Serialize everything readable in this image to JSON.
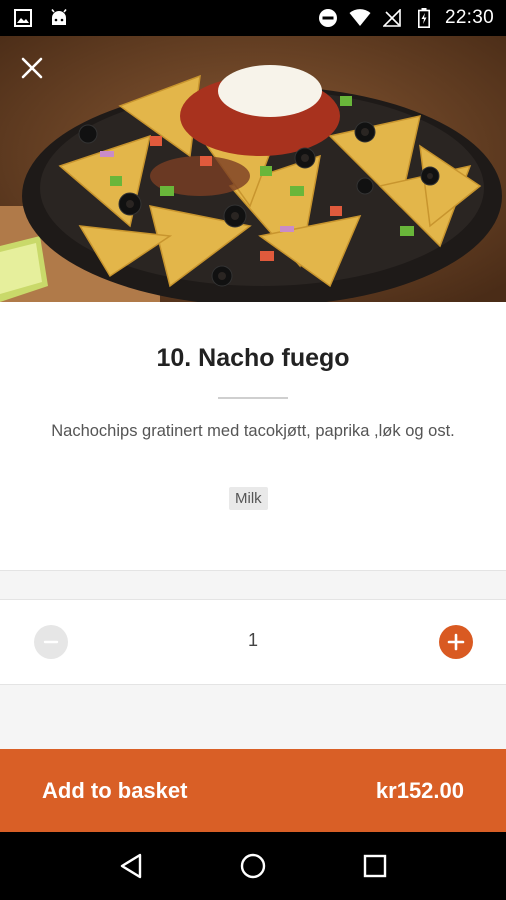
{
  "status_bar": {
    "time": "22:30",
    "icons": [
      "gallery-icon",
      "android-icon",
      "do-not-disturb-icon",
      "wifi-icon",
      "signal-icon",
      "battery-charging-icon"
    ]
  },
  "hero": {
    "image_subject": "nachos in cast iron skillet"
  },
  "header": {
    "close_icon": "close-icon"
  },
  "product": {
    "title": "10. Nacho fuego",
    "description": "Nachochips gratinert med tacokjøtt, paprika ,løk og ost.",
    "allergens": [
      "Milk"
    ]
  },
  "quantity": {
    "value": "1",
    "decrement_icon": "minus-icon",
    "increment_icon": "plus-icon"
  },
  "basket": {
    "label": "Add to basket",
    "price": "kr152.00"
  },
  "nav_bar": {
    "icons": [
      "back-icon",
      "home-icon",
      "recents-icon"
    ]
  },
  "colors": {
    "accent": "#d95f26",
    "minus_disabled": "#e6e6e6",
    "status_bar": "#000000"
  }
}
